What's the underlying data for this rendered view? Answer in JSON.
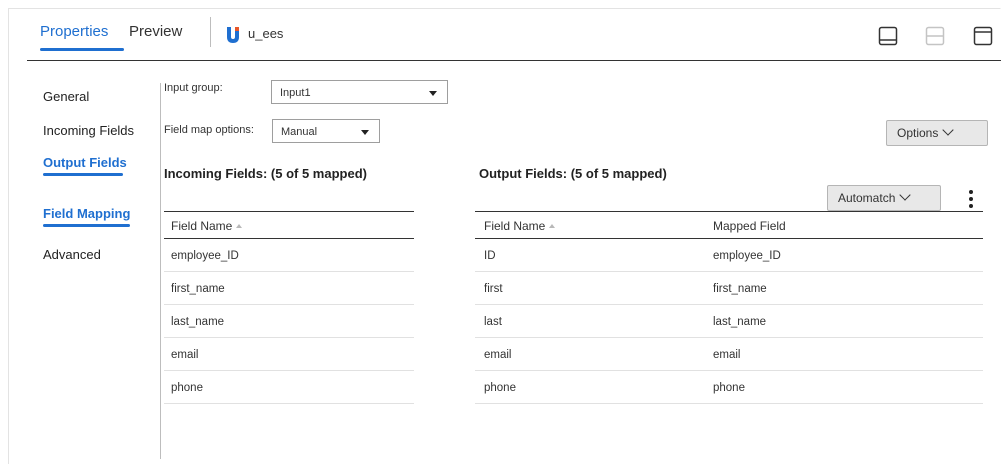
{
  "tabs": {
    "properties": "Properties",
    "preview": "Preview"
  },
  "object": {
    "name": "u_ees",
    "icon": "union-transformation-icon",
    "icon_color": "#1f6fd0",
    "icon_accent": "#e8572a"
  },
  "layout_icons": [
    "panel-bottom-icon",
    "panel-split-icon",
    "panel-top-icon"
  ],
  "nav": {
    "items": [
      {
        "label": "General",
        "active": false
      },
      {
        "label": "Incoming Fields",
        "active": false
      },
      {
        "label": "Output Fields",
        "active": true
      },
      {
        "label": "Field Mapping",
        "active": true
      },
      {
        "label": "Advanced",
        "active": false
      }
    ]
  },
  "form": {
    "input_group_label": "Input group:",
    "input_group_value": "Input1",
    "field_map_label": "Field map options:",
    "field_map_value": "Manual"
  },
  "buttons": {
    "options": "Options",
    "automatch": "Automatch"
  },
  "incoming": {
    "title": "Incoming Fields: (5 of 5 mapped)",
    "header": "Field Name",
    "rows": [
      "employee_ID",
      "first_name",
      "last_name",
      "email",
      "phone"
    ]
  },
  "output": {
    "title": "Output Fields: (5 of 5 mapped)",
    "header_field": "Field Name",
    "header_mapped": "Mapped Field",
    "rows": [
      {
        "field": "ID",
        "mapped": "employee_ID"
      },
      {
        "field": "first",
        "mapped": "first_name"
      },
      {
        "field": "last",
        "mapped": "last_name"
      },
      {
        "field": "email",
        "mapped": "email"
      },
      {
        "field": "phone",
        "mapped": "phone"
      }
    ]
  },
  "colors": {
    "accent": "#1f6fd0",
    "text": "#333333",
    "button_bg": "#e8e8e8"
  }
}
